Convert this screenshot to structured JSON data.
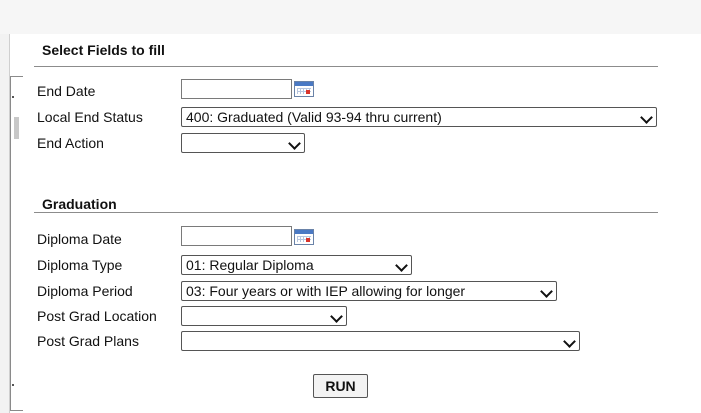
{
  "fields_section": {
    "title": "Select Fields to fill",
    "end_date": {
      "label": "End Date",
      "value": ""
    },
    "local_end_status": {
      "label": "Local End Status",
      "selected": "400: Graduated (Valid 93-94 thru current)"
    },
    "end_action": {
      "label": "End Action",
      "selected": ""
    }
  },
  "graduation_section": {
    "title": "Graduation",
    "diploma_date": {
      "label": "Diploma Date",
      "value": ""
    },
    "diploma_type": {
      "label": "Diploma Type",
      "selected": "01: Regular Diploma"
    },
    "diploma_period": {
      "label": "Diploma Period",
      "selected": "03: Four years or with IEP allowing for longer"
    },
    "post_grad_location": {
      "label": "Post Grad Location",
      "selected": ""
    },
    "post_grad_plans": {
      "label": "Post Grad Plans",
      "selected": ""
    }
  },
  "run_button": {
    "label": "RUN"
  },
  "icons": {
    "date_picker": "calendar-icon",
    "dropdown": "chevron-down-icon"
  }
}
